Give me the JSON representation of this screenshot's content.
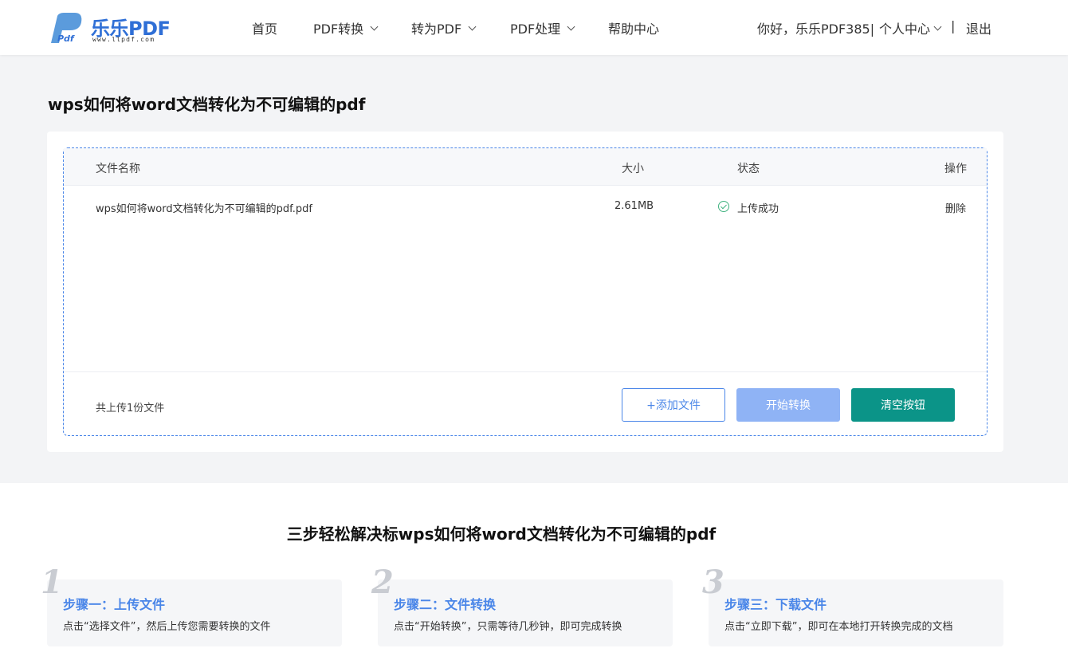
{
  "header": {
    "logo_text": "乐乐PDF",
    "logo_url": "www.llpdf.com",
    "logo_mark": "Pdf",
    "nav": [
      {
        "label": "首页",
        "has_dropdown": false
      },
      {
        "label": "PDF转换",
        "has_dropdown": true
      },
      {
        "label": "转为PDF",
        "has_dropdown": true
      },
      {
        "label": "PDF处理",
        "has_dropdown": true
      },
      {
        "label": "帮助中心",
        "has_dropdown": false
      }
    ],
    "greeting": "你好，乐乐PDF385|",
    "user_center": "个人中心",
    "divider": "|",
    "logout": "退出"
  },
  "page_title": "wps如何将word文档转化为不可编辑的pdf",
  "file_table": {
    "columns": [
      "文件名称",
      "大小",
      "状态",
      "操作"
    ],
    "rows": [
      {
        "name": "wps如何将word文档转化为不可编辑的pdf.pdf",
        "size": "2.61MB",
        "status": "上传成功",
        "action": "删除"
      }
    ],
    "summary": "共上传1份文件"
  },
  "buttons": {
    "add": "+添加文件",
    "start": "开始转换",
    "clear": "清空按钮"
  },
  "steps_title": "三步轻松解决标wps如何将word文档转化为不可编辑的pdf",
  "steps": [
    {
      "num": "1",
      "title": "步骤一：上传文件",
      "desc": "点击“选择文件”，然后上传您需要转换的文件"
    },
    {
      "num": "2",
      "title": "步骤二：文件转换",
      "desc": "点击“开始转换”，只需等待几秒钟，即可完成转换"
    },
    {
      "num": "3",
      "title": "步骤三：下载文件",
      "desc": "点击“立即下载”，即可在本地打开转换完成的文档"
    }
  ],
  "colors": {
    "brand_blue": "#4a86e8",
    "teal": "#0b9488",
    "success_green": "#3fb27f"
  }
}
